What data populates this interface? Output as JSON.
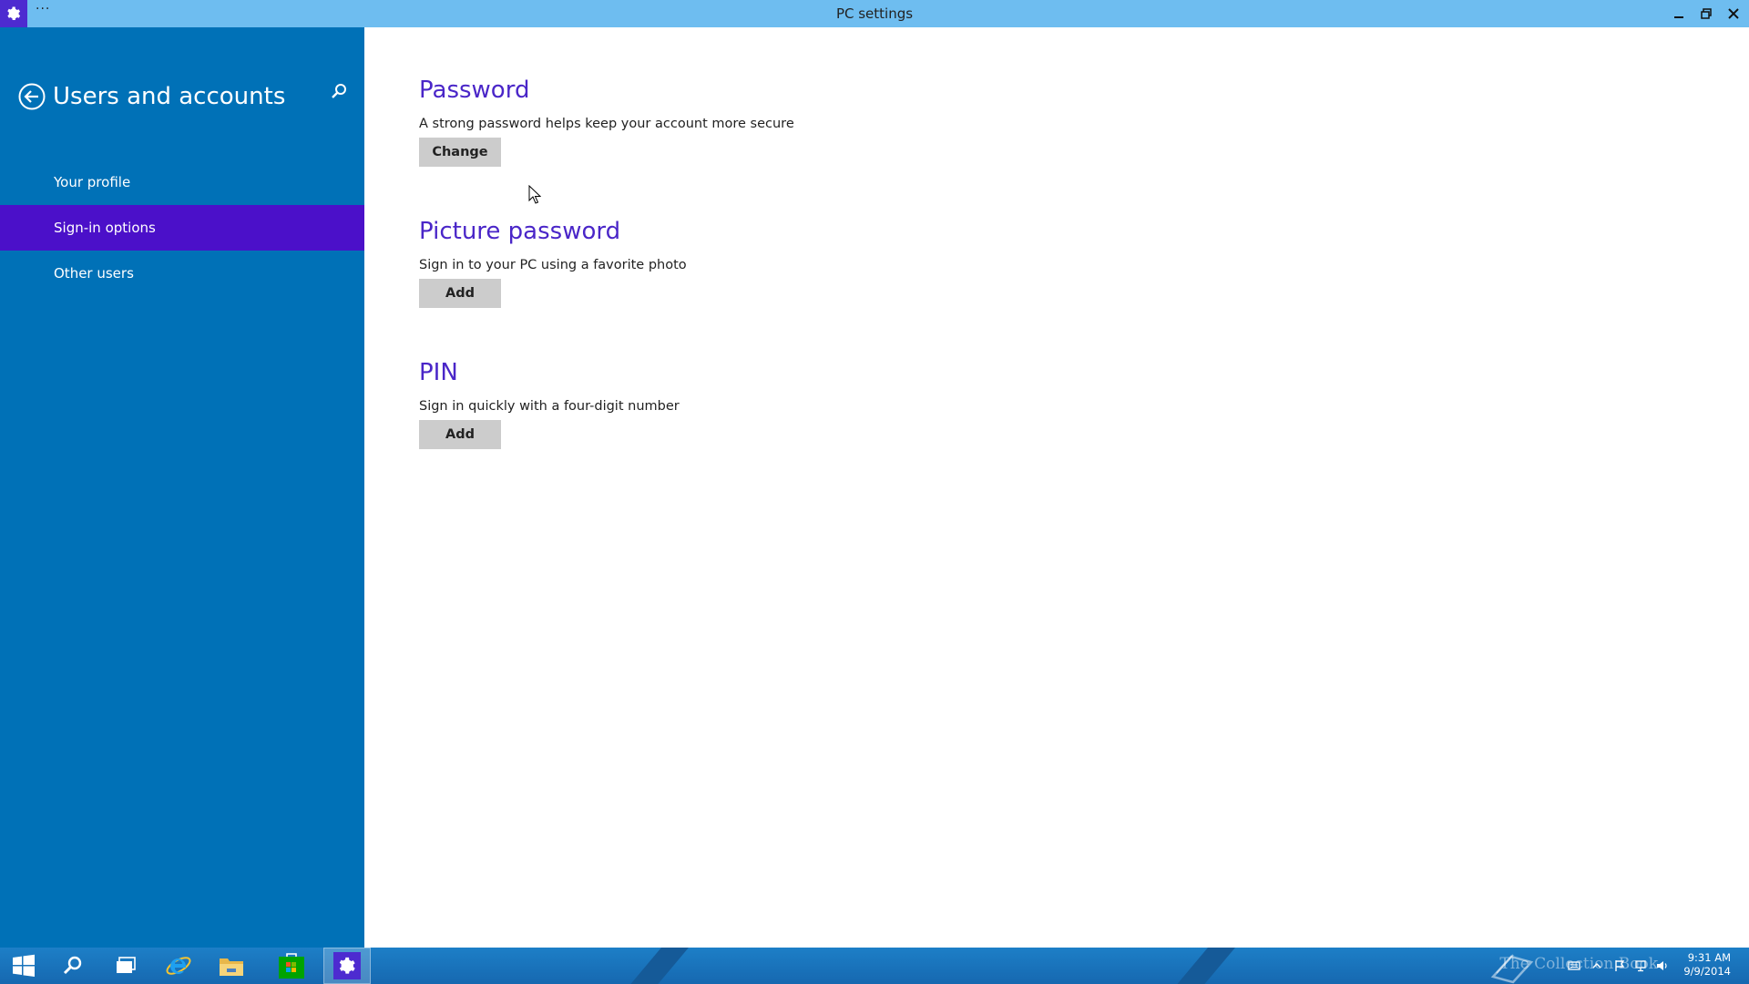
{
  "window": {
    "title": "PC settings",
    "menu_dots": "···"
  },
  "sidebar": {
    "title": "Users and accounts",
    "items": [
      {
        "label": "Your profile",
        "active": false
      },
      {
        "label": "Sign-in options",
        "active": true
      },
      {
        "label": "Other users",
        "active": false
      }
    ]
  },
  "main": {
    "sections": [
      {
        "heading": "Password",
        "description": "A strong password helps keep your account more secure",
        "button_label": "Change"
      },
      {
        "heading": "Picture password",
        "description": "Sign in to your PC using a favorite photo",
        "button_label": "Add"
      },
      {
        "heading": "PIN",
        "description": "Sign in quickly with a four-digit number",
        "button_label": "Add"
      }
    ]
  },
  "taskbar": {
    "apps": [
      "start-icon",
      "search-icon",
      "task-view-icon",
      "internet-explorer-icon",
      "file-explorer-icon",
      "store-icon",
      "settings-icon"
    ],
    "active_app": "settings-icon",
    "clock_time": "9:31 AM",
    "clock_date": "9/9/2014",
    "watermark": "The Collection Book"
  },
  "colors": {
    "titlebar": "#6ebdf0",
    "sidebar": "#0071b7",
    "sidebar_active": "#4b10c9",
    "heading": "#4a26c8",
    "button": "#cccccc"
  }
}
